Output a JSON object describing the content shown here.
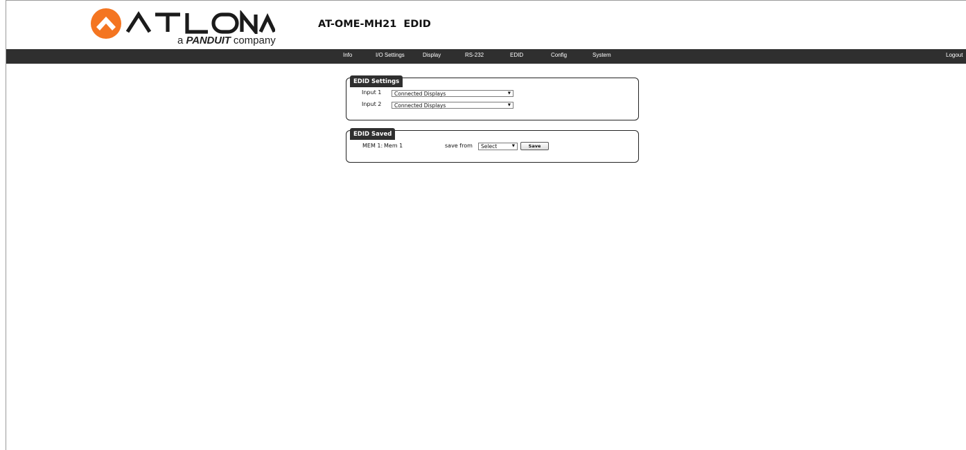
{
  "header": {
    "tagline_prefix": "a",
    "tagline_brand": "PANDUIT",
    "tagline_suffix": "company",
    "page_title": "AT-OME-MH21  EDID",
    "brand_color": "#f47521"
  },
  "nav": {
    "items": [
      "Info",
      "I/O Settings",
      "Display",
      "RS-232",
      "EDID",
      "Config",
      "System"
    ],
    "logout": "Logout"
  },
  "edid_settings": {
    "legend": "EDID Settings",
    "inputs": [
      {
        "label": "Input 1",
        "value": "Connected Displays"
      },
      {
        "label": "Input 2",
        "value": "Connected Displays"
      }
    ]
  },
  "edid_saved": {
    "legend": "EDID Saved",
    "mem_label": "MEM 1:",
    "mem_value": "Mem 1",
    "save_from_label": "save from",
    "save_from_value": "Select",
    "save_button": "Save"
  },
  "icons": {
    "caret": "▼"
  }
}
